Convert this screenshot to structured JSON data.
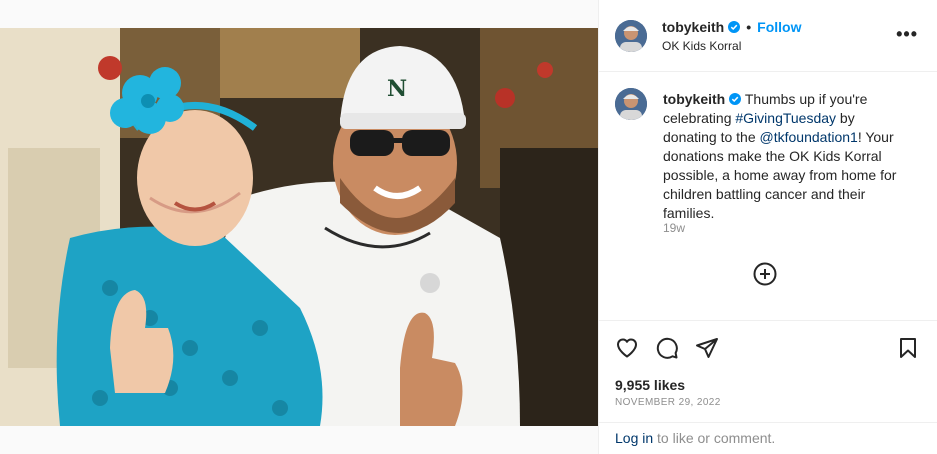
{
  "post": {
    "username": "tobykeith",
    "follow_label": "Follow",
    "location": "OK Kids Korral",
    "more_label": "•••",
    "caption": {
      "username": "tobykeith",
      "text_1": " Thumbs up if you're celebrating ",
      "hashtag": "#GivingTuesday",
      "text_2": " by donating to the ",
      "mention": "@tkfoundation1",
      "text_3": "! Your donations make the OK Kids Korral possible, a home away from home for children battling cancer and their families."
    },
    "time_ago": "19w",
    "likes": "9,955 likes",
    "date": "NOVEMBER 29, 2022",
    "login": {
      "link": "Log in",
      "text": " to like or comment."
    }
  },
  "icons": {
    "verified": "verified-badge-icon",
    "like": "heart-icon",
    "comment": "comment-bubble-icon",
    "share": "paper-plane-icon",
    "save": "bookmark-icon",
    "more": "more-options-icon",
    "add": "plus-circle-icon"
  },
  "colors": {
    "accent": "#0095f6",
    "link": "#00376b",
    "muted": "#8e8e8e",
    "text": "#262626",
    "border": "#efefef"
  }
}
